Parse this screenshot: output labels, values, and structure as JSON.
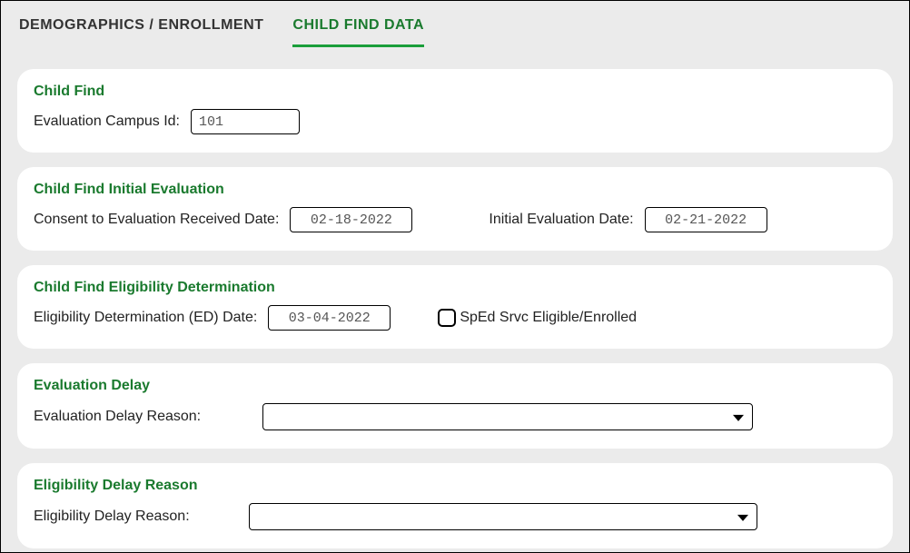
{
  "tabs": {
    "demographics": "DEMOGRAPHICS / ENROLLMENT",
    "childFindData": "CHILD FIND DATA"
  },
  "sections": {
    "childFind": {
      "title": "Child Find",
      "evalCampusLabel": "Evaluation Campus Id:",
      "evalCampusValue": "101"
    },
    "initialEval": {
      "title": "Child Find Initial Evaluation",
      "consentLabel": "Consent to Evaluation Received Date:",
      "consentValue": "02-18-2022",
      "initialEvalLabel": "Initial Evaluation Date:",
      "initialEvalValue": "02-21-2022"
    },
    "eligibility": {
      "title": "Child Find Eligibility Determination",
      "edDateLabel": "Eligibility Determination (ED) Date:",
      "edDateValue": "03-04-2022",
      "spedLabel": "SpEd Srvc Eligible/Enrolled"
    },
    "evalDelay": {
      "title": "Evaluation Delay",
      "label": "Evaluation Delay Reason:",
      "value": ""
    },
    "eligDelay": {
      "title": "Eligibility Delay Reason",
      "label": "Eligibility Delay Reason:",
      "value": ""
    }
  }
}
